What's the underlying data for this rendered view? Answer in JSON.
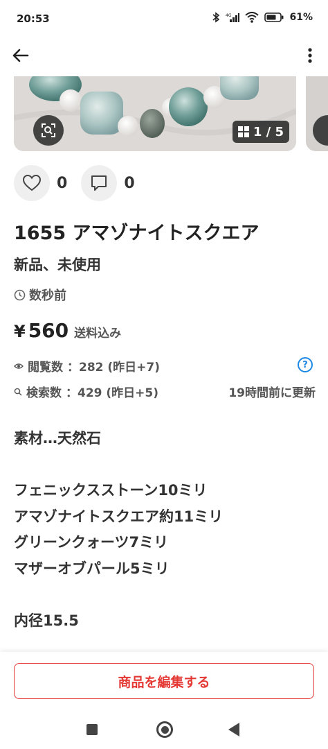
{
  "status_bar": {
    "time": "20:53",
    "battery_percent": "61%",
    "icons": [
      "bluetooth-icon",
      "signal-icon",
      "wifi-icon",
      "battery-icon"
    ]
  },
  "top_bar": {
    "icons": [
      "back-arrow-icon",
      "more-vertical-icon"
    ]
  },
  "carousel": {
    "counter": "1 / 5",
    "icons": [
      "image-search-icon",
      "grid-icon"
    ]
  },
  "reactions": {
    "likes": "0",
    "comments": "0"
  },
  "item": {
    "title": "1655 アマゾナイトスクエア",
    "condition": "新品、未使用",
    "posted": "数秒前",
    "price_symbol": "¥",
    "price": "560",
    "shipping_note": "送料込み"
  },
  "stats": {
    "views_label": "閲覧数",
    "views_value": "：282 (昨日+7)",
    "search_label": "検索数",
    "search_value": "：429 (昨日+5)",
    "updated": "19時間前に更新",
    "help": "?"
  },
  "description": {
    "material": "素材…天然石",
    "line1": "フェニックスストーン10ミリ",
    "line2": "アマゾナイトスクエア約11ミリ",
    "line3": "グリーンクォーツ7ミリ",
    "line4": "マザーオブパール5ミリ",
    "inner_diameter": "内径15.5"
  },
  "actions": {
    "edit_label": "商品を編集する"
  },
  "colors": {
    "accent": "#e53935",
    "info": "#1e88e5",
    "text": "#222222",
    "muted": "#555555"
  }
}
